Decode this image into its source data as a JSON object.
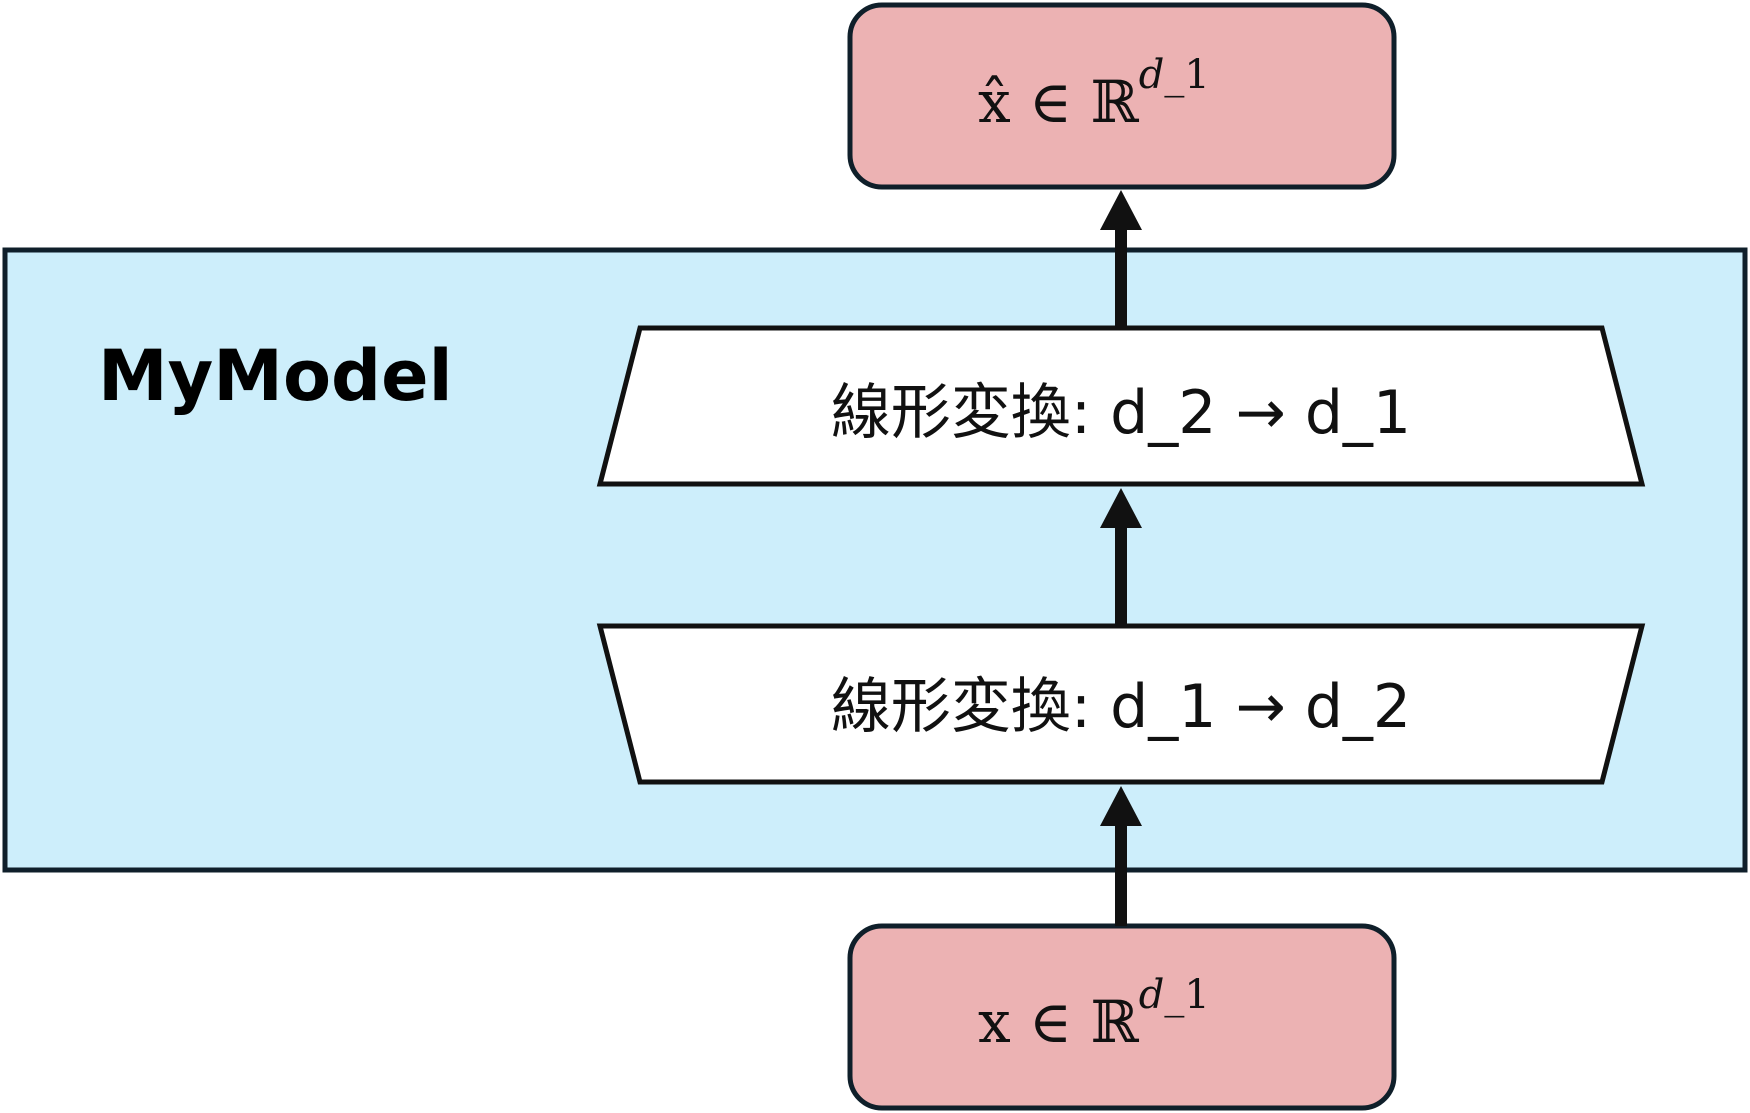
{
  "model": {
    "title": "MyModel"
  },
  "output_node": {
    "base": "x̂ ∈ ℝ",
    "sup_var": "d",
    "sup_rest": "_1"
  },
  "input_node": {
    "base": "x ∈ ℝ",
    "sup_var": "d",
    "sup_rest": "_1"
  },
  "layers": [
    {
      "label": "線形変換: d_1 → d_2"
    },
    {
      "label": "線形変換: d_2 → d_1"
    }
  ],
  "colors": {
    "model_fill": "#cdeefb",
    "node_fill": "#ecb2b3",
    "stroke": "#0f1f2a",
    "arrow": "#111111",
    "layer_fill": "#ffffff"
  }
}
